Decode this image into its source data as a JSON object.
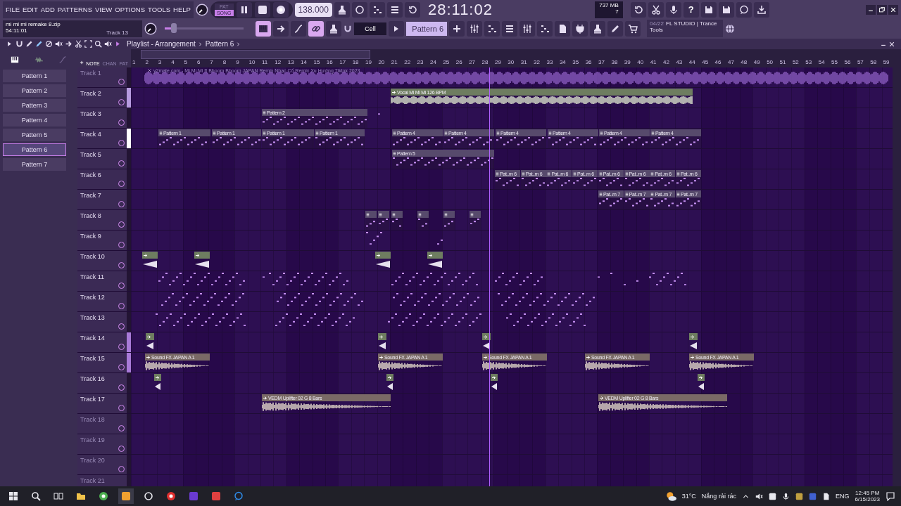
{
  "menu": [
    "FILE",
    "EDIT",
    "ADD",
    "PATTERNS",
    "VIEW",
    "OPTIONS",
    "TOOLS",
    "HELP"
  ],
  "transport": {
    "modes": [
      {
        "label": "PAT",
        "selected": false
      },
      {
        "label": "SONG",
        "selected": true
      }
    ],
    "tempo": "138.000",
    "time": "28:11:02",
    "memory": "737 MB",
    "cpu": "7"
  },
  "help": "?",
  "song": {
    "file": "mi mi mi remake 8.zip",
    "time": "54:11:01",
    "track": "Track 13"
  },
  "master_pitch": {
    "level": 0.12
  },
  "tool_toggles": [
    {
      "on": true
    },
    {
      "on": false
    },
    {
      "on": false
    },
    {
      "on": true
    },
    {
      "on": false
    }
  ],
  "snap": "Cell",
  "pattern_selector": "Pattern 6",
  "news": {
    "date": "04/22",
    "title": "FL STUDIO | Trance",
    "subtitle": "Tools"
  },
  "playlist": {
    "title": "Playlist - Arrangement",
    "crumb": "Pattern 6"
  },
  "view_tabs": [
    {
      "label": "NOTE",
      "selected": true
    },
    {
      "label": "CHAN",
      "selected": false
    },
    {
      "label": "PAT",
      "selected": false
    }
  ],
  "patterns": [
    {
      "name": "Pattern 1",
      "selected": false
    },
    {
      "name": "Pattern 2",
      "selected": false
    },
    {
      "name": "Pattern 3",
      "selected": false
    },
    {
      "name": "Pattern 4",
      "selected": false
    },
    {
      "name": "Pattern 5",
      "selected": false
    },
    {
      "name": "Pattern 6",
      "selected": true
    },
    {
      "name": "Pattern 7",
      "selected": false
    }
  ],
  "ruler": [
    "1",
    "2",
    "3",
    "4",
    "5",
    "6",
    "7",
    "8",
    "9",
    "10",
    "11",
    "12",
    "13",
    "14",
    "15",
    "16",
    "17",
    "18",
    "19",
    "20",
    "21",
    "22",
    "23",
    "24",
    "25",
    "26",
    "27",
    "28",
    "29",
    "30",
    "31",
    "32",
    "33",
    "34",
    "35",
    "36",
    "37",
    "38",
    "39",
    "40",
    "41",
    "42",
    "43",
    "44",
    "45",
    "46",
    "47",
    "48",
    "49",
    "50",
    "51",
    "52",
    "53",
    "54",
    "55",
    "56",
    "57",
    "58",
    "59"
  ],
  "playhead": {
    "level": 0.47
  },
  "tracks": [
    {
      "name": "Track 1",
      "dimmed": true,
      "clips": [
        {
          "kind": "trace",
          "label": "y2mate.com - Mi Mi Mi ft Bboom Bboom JAPAN Remix  Nhạc Cổ Remix Xu Hướng Tiktok 2023"
        }
      ]
    },
    {
      "name": "Track 2",
      "dimmed": false,
      "color": "#b79be0",
      "clips": [
        {
          "kind": "audio",
          "label": "Vocal Mi Mi Mi 126 BPM"
        }
      ]
    },
    {
      "name": "Track 3",
      "dimmed": false,
      "clips": [
        {
          "kind": "pattern",
          "label": "Pattern 2"
        },
        {
          "kind": "notes"
        }
      ]
    },
    {
      "name": "Track 4",
      "dimmed": false,
      "color": "#ffffff",
      "clips": [
        {
          "kind": "pattern",
          "label": "Pattern 1"
        },
        {
          "kind": "pattern",
          "label": "Pattern 1"
        },
        {
          "kind": "pattern",
          "label": "Pattern 1"
        },
        {
          "kind": "pattern",
          "label": "Pattern 1"
        },
        {
          "kind": "pattern",
          "label": "Pattern 4"
        },
        {
          "kind": "pattern",
          "label": "Pattern 4"
        },
        {
          "kind": "pattern",
          "label": "Pattern 4"
        },
        {
          "kind": "pattern",
          "label": "Pattern 4"
        },
        {
          "kind": "pattern",
          "label": "Pattern 4"
        },
        {
          "kind": "pattern",
          "label": "Pattern 4"
        }
      ]
    },
    {
      "name": "Track 5",
      "dimmed": false,
      "clips": [
        {
          "kind": "pattern",
          "label": "Pattern 5"
        }
      ]
    },
    {
      "name": "Track 6",
      "dimmed": false,
      "clips": [
        {
          "kind": "pattern",
          "label": "Pat..rn 6"
        },
        {
          "kind": "pattern",
          "label": "Pat..rn 6"
        },
        {
          "kind": "pattern",
          "label": "Pat..rn 6"
        },
        {
          "kind": "pattern",
          "label": "Pat..rn 6"
        },
        {
          "kind": "pattern",
          "label": "Pat..rn 6"
        },
        {
          "kind": "pattern",
          "label": "Pat..rn 6"
        },
        {
          "kind": "pattern",
          "label": "Pat..rn 6"
        },
        {
          "kind": "pattern",
          "label": "Pat..rn 6"
        }
      ]
    },
    {
      "name": "Track 7",
      "dimmed": false,
      "clips": [
        {
          "kind": "pattern",
          "label": "Pat..rn 7"
        },
        {
          "kind": "pattern",
          "label": "Pat..rn 7"
        },
        {
          "kind": "pattern",
          "label": "Pat..rn 7"
        },
        {
          "kind": "pattern",
          "label": "Pat..rn 7"
        }
      ]
    },
    {
      "name": "Track 8",
      "dimmed": false,
      "clips": [
        {
          "kind": "pattern"
        },
        {
          "kind": "pattern"
        },
        {
          "kind": "pattern"
        },
        {
          "kind": "pattern"
        },
        {
          "kind": "pattern"
        },
        {
          "kind": "pattern"
        }
      ]
    },
    {
      "name": "Track 9",
      "dimmed": false,
      "clips": [
        {
          "kind": "notes"
        },
        {
          "kind": "notes"
        }
      ]
    },
    {
      "name": "Track 10",
      "dimmed": false,
      "clips": [
        {
          "kind": "short"
        },
        {
          "kind": "short"
        },
        {
          "kind": "short"
        },
        {
          "kind": "short"
        }
      ]
    },
    {
      "name": "Track 11",
      "dimmed": false,
      "clips": [
        {
          "kind": "notes"
        },
        {
          "kind": "notes"
        },
        {
          "kind": "notes"
        },
        {
          "kind": "notes"
        },
        {
          "kind": "notes"
        },
        {
          "kind": "notes"
        },
        {
          "kind": "notes"
        },
        {
          "kind": "notes"
        },
        {
          "kind": "notes"
        },
        {
          "kind": "notes"
        }
      ]
    },
    {
      "name": "Track 12",
      "dimmed": false,
      "clips": [
        {
          "kind": "notes"
        },
        {
          "kind": "notes"
        },
        {
          "kind": "notes"
        },
        {
          "kind": "notes"
        }
      ]
    },
    {
      "name": "Track 13",
      "dimmed": false,
      "clips": [
        {
          "kind": "notes"
        },
        {
          "kind": "notes"
        },
        {
          "kind": "notes"
        },
        {
          "kind": "notes"
        }
      ]
    },
    {
      "name": "Track 14",
      "dimmed": false,
      "color": "#a87ad8",
      "clips": [
        {
          "kind": "short"
        },
        {
          "kind": "short"
        },
        {
          "kind": "short"
        },
        {
          "kind": "short"
        }
      ]
    },
    {
      "name": "Track 15",
      "dimmed": false,
      "color": "#a87ad8",
      "clips": [
        {
          "kind": "sample",
          "label": "Sound FX JAPAN A 1"
        },
        {
          "kind": "sample",
          "label": "Sound FX JAPAN A 1"
        },
        {
          "kind": "sample",
          "label": "Sound FX JAPAN A 1"
        },
        {
          "kind": "sample",
          "label": "Sound FX JAPAN A 1"
        },
        {
          "kind": "sample",
          "label": "Sound FX JAPAN A 1"
        }
      ]
    },
    {
      "name": "Track 16",
      "dimmed": false,
      "clips": [
        {
          "kind": "short"
        },
        {
          "kind": "short"
        },
        {
          "kind": "short"
        },
        {
          "kind": "short"
        }
      ]
    },
    {
      "name": "Track 17",
      "dimmed": false,
      "clips": [
        {
          "kind": "sample",
          "label": "VEDM Uplifter 02 G 8 Bars"
        },
        {
          "kind": "sample",
          "label": "VEDM Uplifter 02 G 8 Bars"
        }
      ]
    },
    {
      "name": "Track 18",
      "dimmed": true
    },
    {
      "name": "Track 19",
      "dimmed": true
    },
    {
      "name": "Track 20",
      "dimmed": true
    },
    {
      "name": "Track 21",
      "dimmed": true
    }
  ],
  "taskbar": {
    "temperature": "31°C",
    "weather": "Nắng rải rác",
    "language": "ENG",
    "time": "12:45 PM",
    "date": "6/15/2023"
  }
}
